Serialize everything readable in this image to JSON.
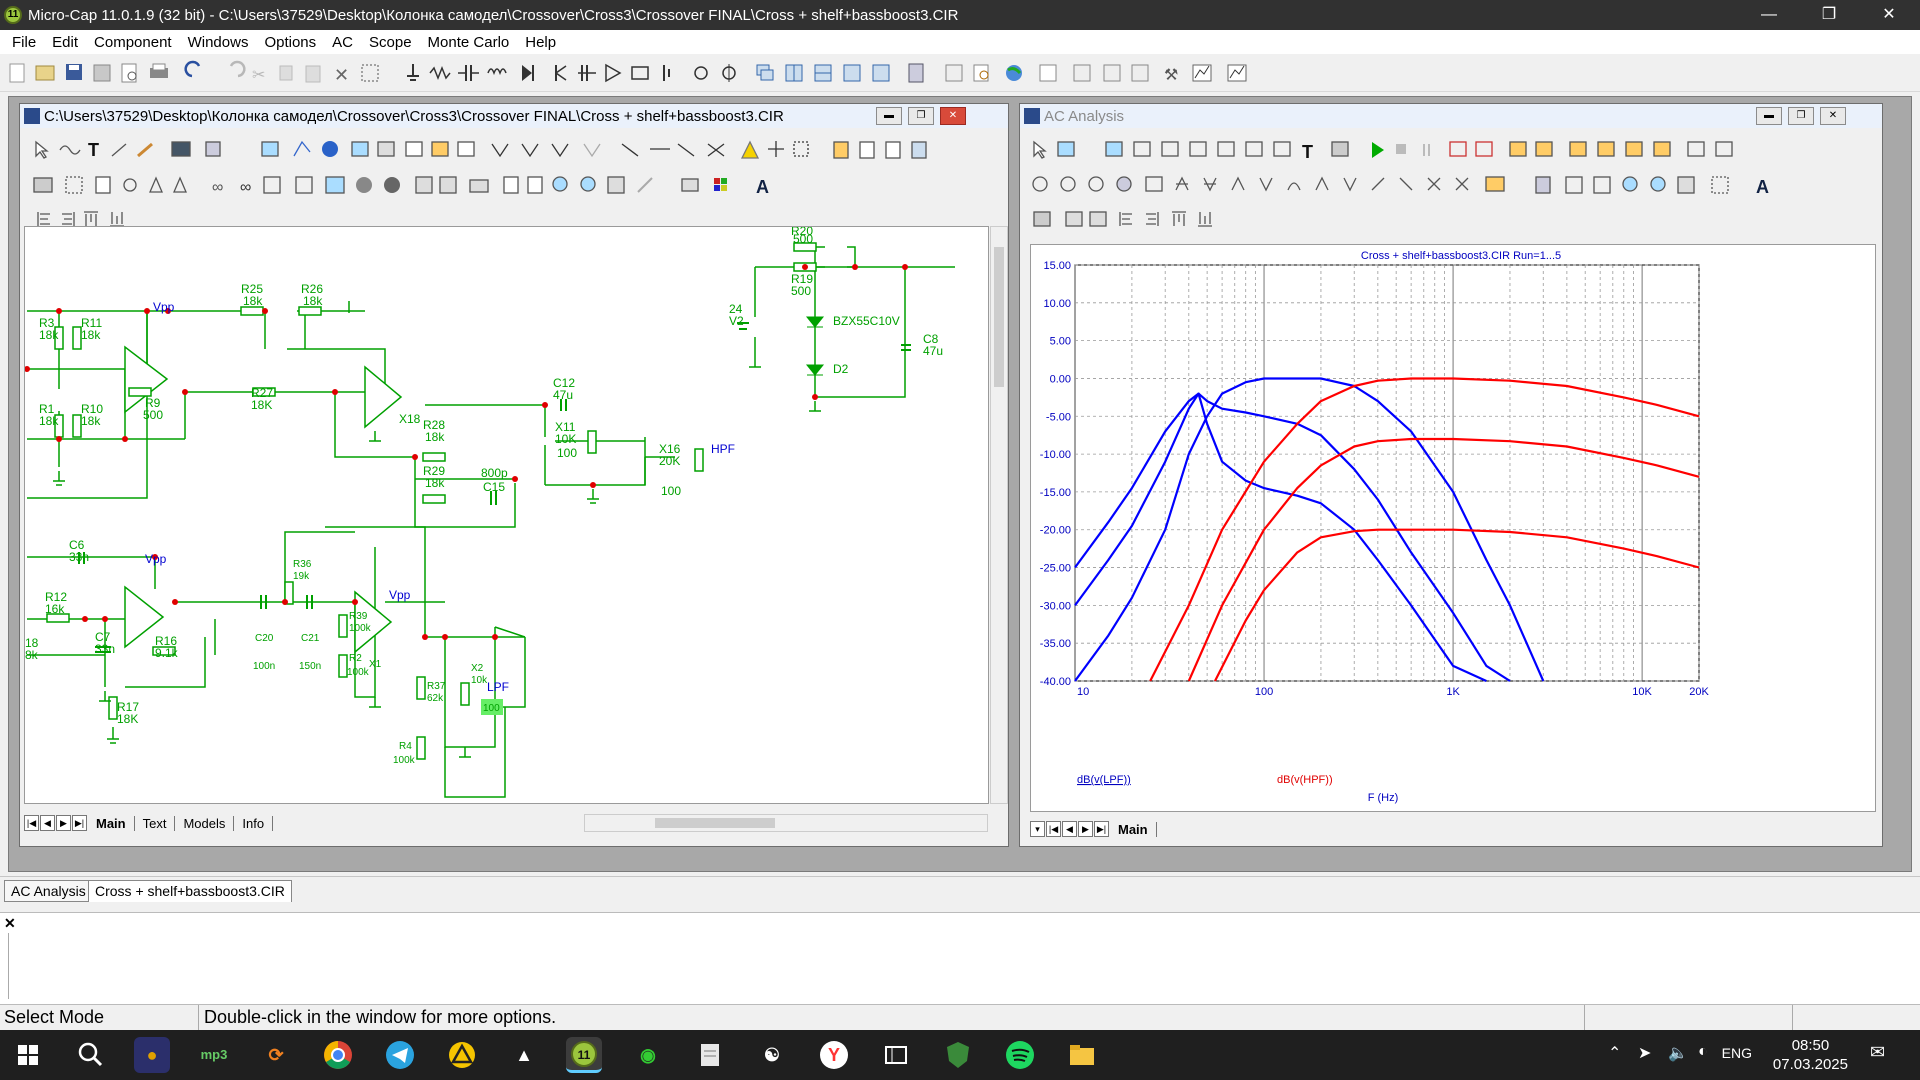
{
  "app": {
    "title": "Micro-Cap 11.0.1.9 (32 bit) - C:\\Users\\37529\\Desktop\\Колонка самодел\\Crossover\\Cross3\\Crossover FINAL\\Cross + shelf+bassboost3.CIR"
  },
  "menu": [
    "File",
    "Edit",
    "Component",
    "Windows",
    "Options",
    "AC",
    "Scope",
    "Monte Carlo",
    "Help"
  ],
  "schematic_window": {
    "title": "C:\\Users\\37529\\Desktop\\Колонка самодел\\Crossover\\Cross3\\Crossover FINAL\\Cross + shelf+bassboost3.CIR",
    "tabs": [
      "Main",
      "Text",
      "Models",
      "Info"
    ],
    "labels": {
      "vpp1": "Vpp",
      "r25": "R25",
      "r25v": "18k",
      "r26": "R26",
      "r26v": "18k",
      "r3": "R3",
      "r3v": "18k",
      "r11": "R11",
      "r11v": "18k",
      "r9": "R9",
      "r9v": "500",
      "r27": "R27",
      "r27v": "18K",
      "x18": "X18",
      "r28": "R28",
      "r28v": "18k",
      "r29": "R29",
      "r29v": "18k",
      "c15v": "800p",
      "c15": "C15",
      "r1": "R1",
      "r1v": "18k",
      "r10": "R10",
      "r10v": "18k",
      "c12": "C12",
      "c12v": "47u",
      "x11": "X11",
      "x11v": "10K",
      "x11v2": "100",
      "x16": "X16",
      "x16v": "20K",
      "x16v2": "100",
      "hpf": "HPF",
      "r20": "R20",
      "r20v": "500",
      "r19": "R19",
      "r19v": "500",
      "v2v": "24",
      "v2": "V2",
      "bzx": "BZX55C10V",
      "d2": "D2",
      "c8": "C8",
      "c8v": "47u",
      "c6": "C6",
      "c6v": "33n",
      "vpp2": "Vpp",
      "r12": "R12",
      "r12v": "16k",
      "c7": "C7",
      "c7v": "33n",
      "r16": "R16",
      "r16v": "9.1k",
      "r17": "R17",
      "r17v": "18K",
      "r18v": "18",
      "r18v2": "8k",
      "r36": "R36",
      "r36v": "19k",
      "vpp3": "Vpp",
      "r39": "R39",
      "r39v": "100k",
      "c20": "C20",
      "c20v": "100n",
      "c21": "C21",
      "c21v": "150n",
      "r2": "R2",
      "r2v": "100k",
      "x1": "X1",
      "r37": "R37",
      "r37v": "62k",
      "x2": "X2",
      "x2v": "10k",
      "x2v2": "100",
      "lpf": "LPF",
      "r4": "R4",
      "r4v": "100k"
    }
  },
  "ac_window": {
    "title": "AC Analysis",
    "tabs": [
      "Main"
    ]
  },
  "chart_data": {
    "type": "line",
    "title": "Cross + shelf+bassboost3.CIR Run=1...5",
    "xlabel": "F (Hz)",
    "xscale": "log",
    "xlim": [
      10,
      20000
    ],
    "ylim": [
      -40,
      15
    ],
    "grid": true,
    "xticks": [
      "10",
      "100",
      "1K",
      "10K",
      "20K"
    ],
    "yticks": [
      "15.00",
      "10.00",
      "5.00",
      "0.00",
      "-5.00",
      "-10.00",
      "-15.00",
      "-20.00",
      "-25.00",
      "-30.00",
      "-35.00",
      "-40.00"
    ],
    "legend": [
      "dB(v(LPF))",
      "dB(v(HPF))"
    ],
    "series": [
      {
        "name": "dB(v(LPF))",
        "color": "#0000ff",
        "x": [
          10,
          15,
          20,
          30,
          40,
          45,
          50,
          60,
          80,
          100,
          150,
          200,
          300,
          400,
          600,
          1000,
          1500,
          2000
        ],
        "y": [
          -25,
          -19,
          -14.5,
          -7,
          -3,
          -2,
          -3,
          -4,
          -4.5,
          -5,
          -6,
          -7.5,
          -12,
          -16,
          -23,
          -31,
          -38,
          -40
        ]
      },
      {
        "name": "dB(v(LPF))",
        "color": "#0000ff",
        "x": [
          10,
          15,
          20,
          30,
          40,
          45,
          50,
          60,
          80,
          100,
          150,
          200,
          300,
          400,
          600,
          1000,
          1500
        ],
        "y": [
          -30,
          -24,
          -19.5,
          -11,
          -4,
          -2,
          -6,
          -11,
          -13.5,
          -14.5,
          -15.5,
          -16.5,
          -20,
          -24,
          -30,
          -38,
          -40
        ]
      },
      {
        "name": "dB(v(LPF))",
        "color": "#0000ff",
        "x": [
          10,
          15,
          20,
          30,
          40,
          50,
          60,
          80,
          100,
          150,
          200,
          300,
          400,
          600,
          1000,
          1500,
          2000,
          3000
        ],
        "y": [
          -40,
          -34,
          -29,
          -20,
          -10,
          -5,
          -2,
          -0.5,
          0,
          0,
          0,
          -1,
          -3,
          -7,
          -15,
          -24,
          -30,
          -40
        ]
      },
      {
        "name": "dB(v(HPF))",
        "color": "#ff0000",
        "x": [
          25,
          40,
          60,
          100,
          150,
          200,
          300,
          400,
          600,
          1000,
          2000,
          4000,
          8000,
          12000,
          20000
        ],
        "y": [
          -40,
          -30,
          -20,
          -11,
          -6,
          -3,
          -1,
          -0.3,
          0,
          0,
          -0.3,
          -1,
          -2.5,
          -3.5,
          -5
        ]
      },
      {
        "name": "dB(v(HPF))",
        "color": "#ff0000",
        "x": [
          40,
          60,
          100,
          150,
          200,
          300,
          400,
          600,
          1000,
          2000,
          4000,
          8000,
          12000,
          20000
        ],
        "y": [
          -40,
          -30,
          -20,
          -14.5,
          -11.5,
          -9,
          -8.3,
          -8,
          -8,
          -8.3,
          -9,
          -10.5,
          -11.5,
          -13
        ]
      },
      {
        "name": "dB(v(HPF))",
        "color": "#ff0000",
        "x": [
          55,
          80,
          100,
          150,
          200,
          300,
          400,
          600,
          1000,
          2000,
          4000,
          8000,
          12000,
          20000
        ],
        "y": [
          -40,
          -32,
          -28,
          -23,
          -21,
          -20.2,
          -20,
          -20,
          -20,
          -20.3,
          -21,
          -22.5,
          -23.5,
          -25
        ]
      }
    ]
  },
  "doc_tabs": [
    "AC Analysis",
    "Cross + shelf+bassboost3.CIR"
  ],
  "status": {
    "mode": "Select Mode",
    "hint": "Double-click in the window for more options."
  },
  "taskbar": {
    "lang": "ENG",
    "time": "08:50",
    "date": "07.03.2025"
  }
}
